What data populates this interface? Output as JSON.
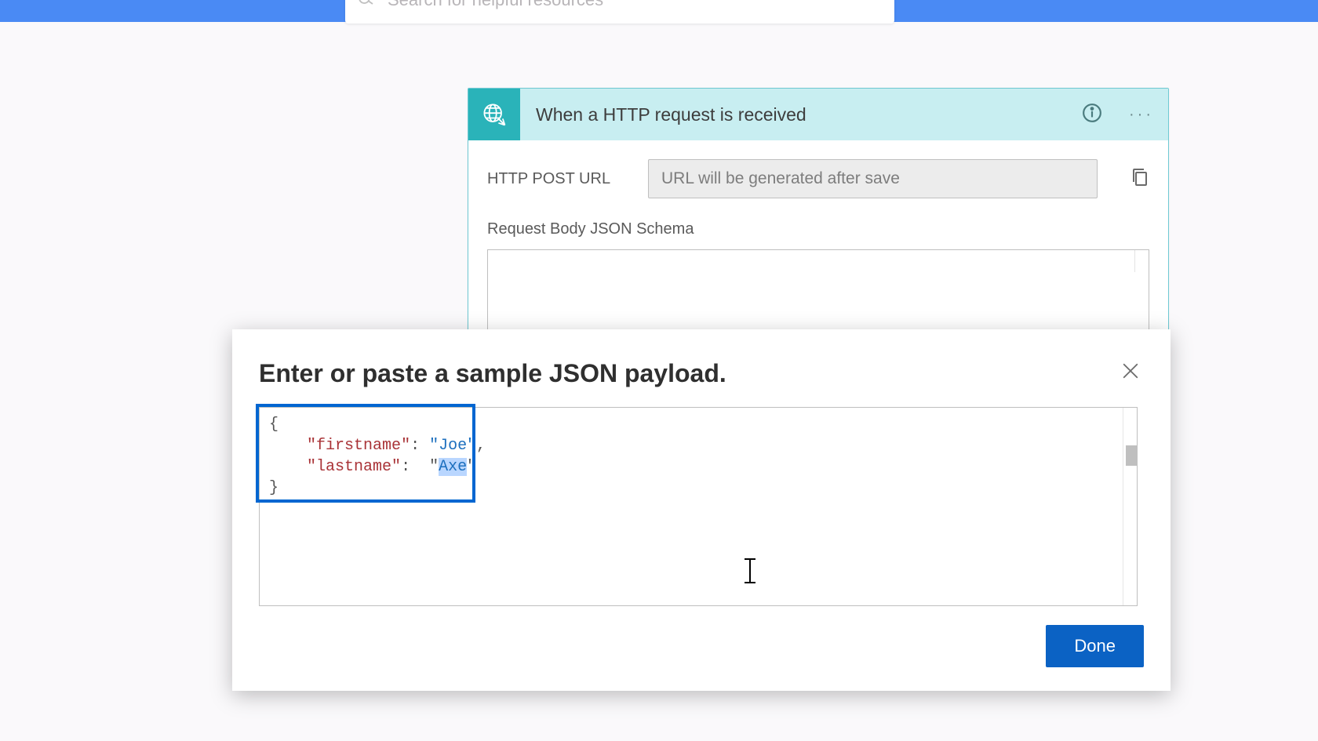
{
  "search": {
    "placeholder": "Search for helpful resources"
  },
  "trigger": {
    "title": "When a HTTP request is received",
    "url_label": "HTTP POST URL",
    "url_placeholder": "URL will be generated after save",
    "schema_label": "Request Body JSON Schema"
  },
  "modal": {
    "title": "Enter or paste a sample JSON payload.",
    "done_label": "Done",
    "json_sample": {
      "key1": "firstname",
      "val1": "Joe",
      "key2": "lastname",
      "val2": "Axe"
    }
  }
}
